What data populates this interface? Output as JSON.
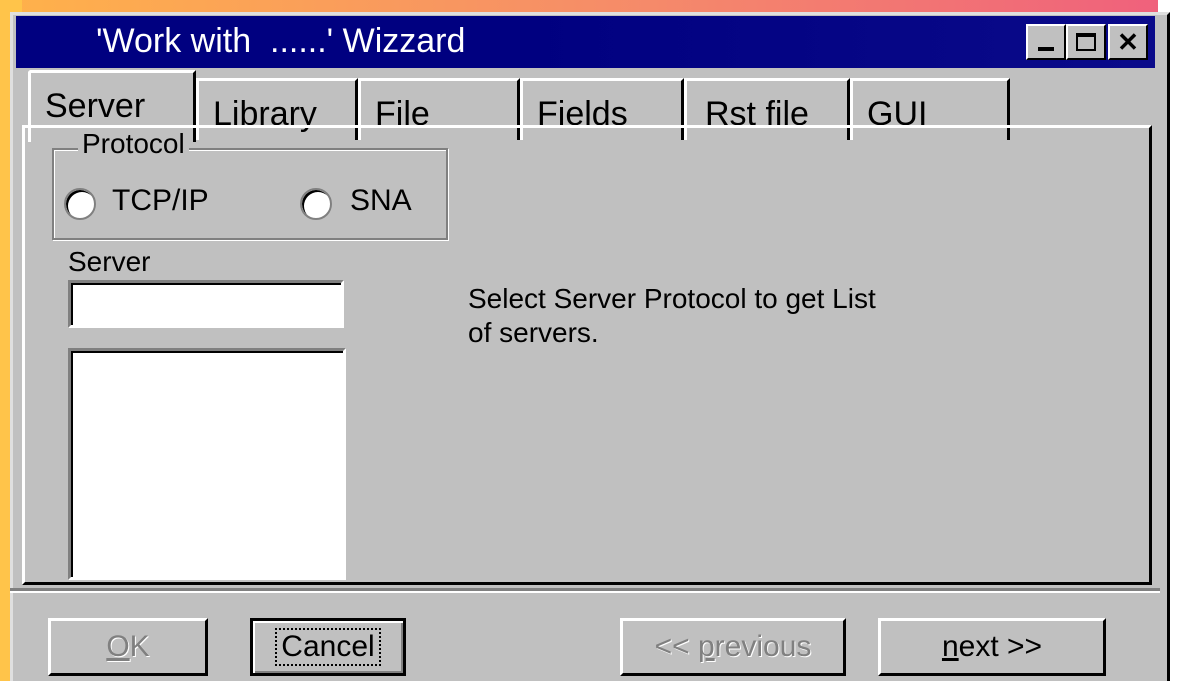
{
  "window": {
    "title": "'Work with  ......' Wizzard",
    "controls": {
      "minimize": "_",
      "maximize": "□",
      "close": "✕"
    }
  },
  "tabs": [
    {
      "label": "Server",
      "active": true
    },
    {
      "label": "Library",
      "active": false
    },
    {
      "label": "File",
      "active": false
    },
    {
      "label": "Fields",
      "active": false
    },
    {
      "label": "Rst file",
      "active": false
    },
    {
      "label": "GUI",
      "active": false
    }
  ],
  "protocol": {
    "legend": "Protocol",
    "options": [
      {
        "label": "TCP/IP",
        "selected": false
      },
      {
        "label": "SNA",
        "selected": false
      }
    ]
  },
  "server": {
    "label": "Server",
    "value": "",
    "list_items": []
  },
  "message": {
    "line1": "Select Server Protocol to get List",
    "line2": "of servers."
  },
  "buttons": {
    "ok": {
      "label": "OK",
      "underline": "O",
      "rest": "K",
      "enabled": false
    },
    "cancel": {
      "label": "Cancel",
      "enabled": true
    },
    "previous": {
      "prefix": "<< ",
      "underline": "p",
      "rest": "revious",
      "enabled": false
    },
    "next": {
      "underline": "n",
      "rest": "ext >>",
      "enabled": true
    }
  },
  "colors": {
    "titlebar": "#000080",
    "face": "#c0c0c0",
    "background_accent": "#ffc44a"
  }
}
